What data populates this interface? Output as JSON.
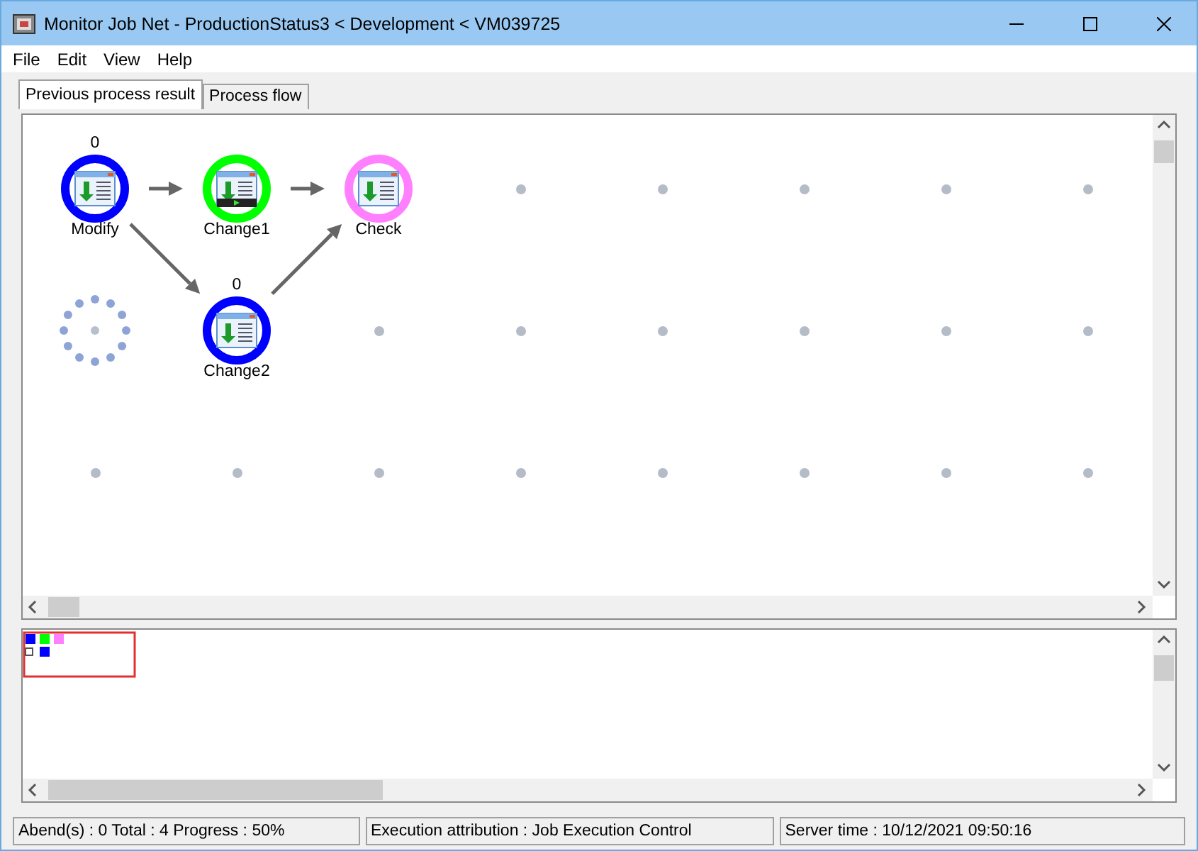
{
  "window": {
    "title": "Monitor Job Net - ProductionStatus3 < Development < VM039725"
  },
  "menu": [
    {
      "label": "File"
    },
    {
      "label": "Edit"
    },
    {
      "label": "View"
    },
    {
      "label": "Help"
    }
  ],
  "tabs": [
    {
      "label": "Previous process result",
      "selected": true
    },
    {
      "label": "Process flow",
      "selected": false
    }
  ],
  "grid": [
    [
      {
        "kind": "job",
        "name": "Modify",
        "count": "0",
        "color": "#0000ff",
        "running": false,
        "arrow_right": true,
        "arrow_down_right": true,
        "arrow_up_right": false
      },
      {
        "kind": "job",
        "name": "Change1",
        "color": "#00ff00",
        "running": true,
        "arrow_right": true,
        "arrow_down_right": false,
        "arrow_up_right": false
      },
      {
        "kind": "job",
        "name": "Check",
        "color": "#ff80ff",
        "running": false,
        "arrow_right": false,
        "arrow_down_right": false,
        "arrow_up_right": false
      },
      {
        "kind": "dot"
      },
      {
        "kind": "dot"
      },
      {
        "kind": "dot"
      },
      {
        "kind": "dot"
      },
      {
        "kind": "dot"
      }
    ],
    [
      {
        "kind": "busy"
      },
      {
        "kind": "job",
        "name": "Change2",
        "count": "0",
        "color": "#0000ff",
        "running": false,
        "arrow_right": false,
        "arrow_down_right": false,
        "arrow_up_right": true
      },
      {
        "kind": "dot"
      },
      {
        "kind": "dot"
      },
      {
        "kind": "dot"
      },
      {
        "kind": "dot"
      },
      {
        "kind": "dot"
      },
      {
        "kind": "dot"
      }
    ],
    [
      {
        "kind": "dot"
      },
      {
        "kind": "dot"
      },
      {
        "kind": "dot"
      },
      {
        "kind": "dot"
      },
      {
        "kind": "dot"
      },
      {
        "kind": "dot"
      },
      {
        "kind": "dot"
      },
      {
        "kind": "dot"
      }
    ]
  ],
  "status_bar": [
    "Abend(s) : 0 Total : 4 Progress : 50%",
    "Execution attribution : Job Execution Control",
    "Server time : 10/12/2021 09:50:16"
  ]
}
